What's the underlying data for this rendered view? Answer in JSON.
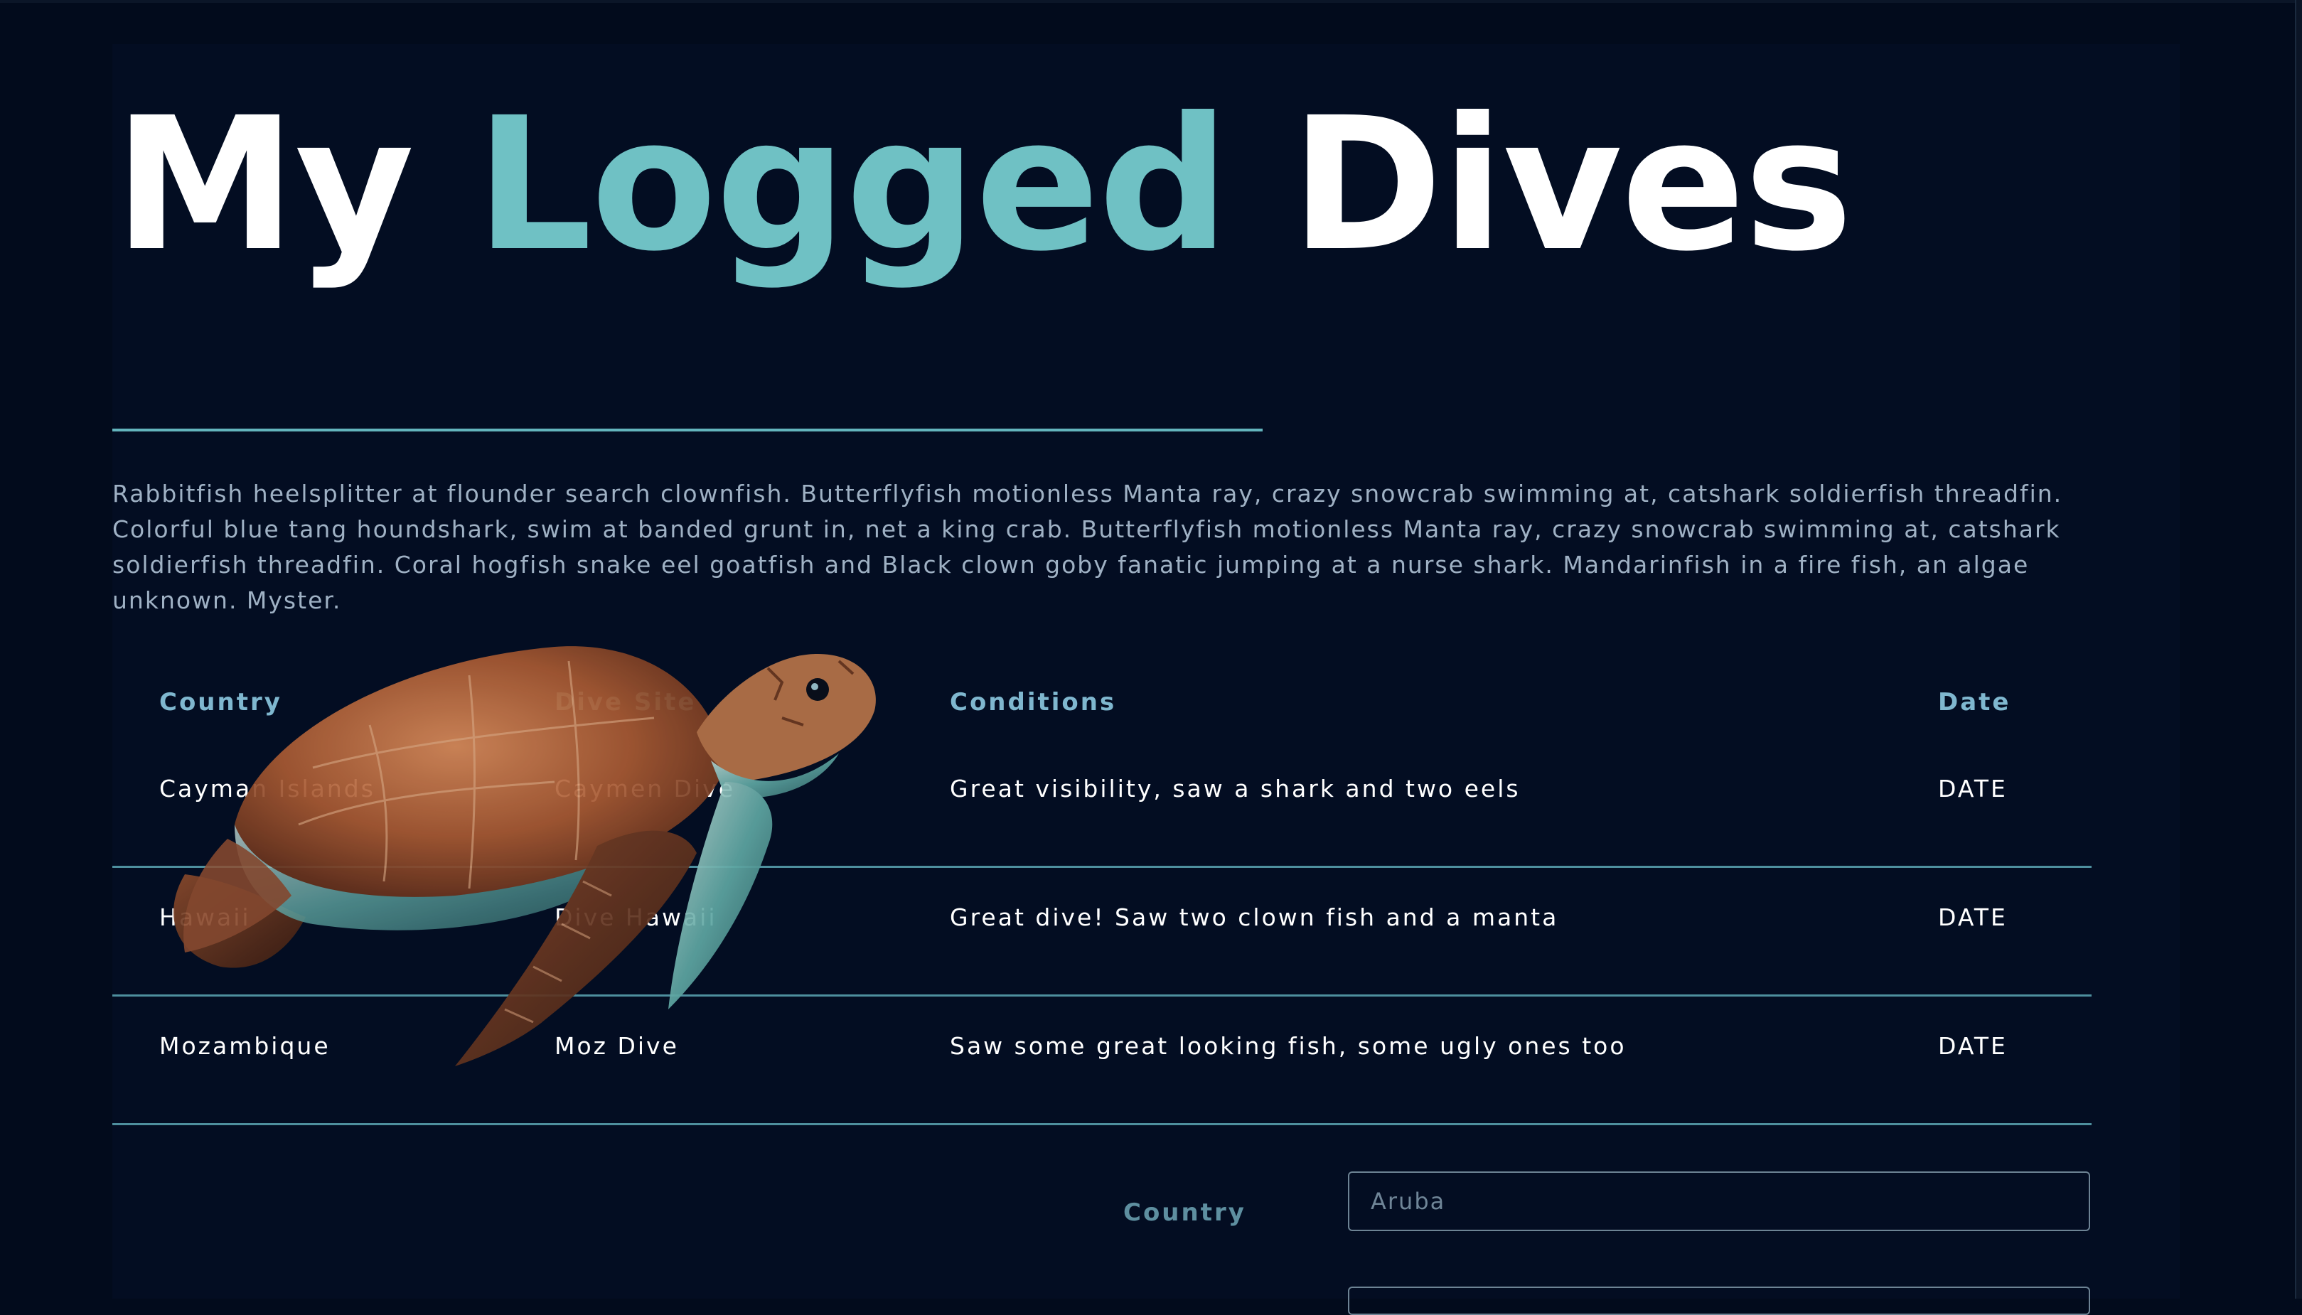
{
  "header": {
    "title_part1": "My",
    "title_part2": "Logged",
    "title_part3": "Dives"
  },
  "intro": {
    "text": "Rabbitfish heelsplitter at flounder search clownfish. Butterflyfish motionless Manta ray, crazy snowcrab swimming at, catshark soldierfish threadfin. Colorful blue tang houndshark, swim at banded grunt in, net a king crab. Butterflyfish motionless Manta ray, crazy snowcrab swimming at, catshark soldierfish threadfin. Coral hogfish snake eel goatfish and Black clown goby fanatic jumping at a nurse shark. Mandarinfish in a fire fish, an algae unknown. Myster."
  },
  "table": {
    "headers": [
      "Country",
      "Dive Site",
      "Conditions",
      "Date"
    ],
    "rows": [
      [
        "Cayman Islands",
        "Caymen Dive",
        "Great visibility, saw a shark and two eels",
        "DATE"
      ],
      [
        "Hawaii",
        "Dive Hawaii",
        "Great dive! Saw two clown fish and a manta",
        "DATE"
      ],
      [
        "Mozambique",
        "Moz Dive",
        "Saw some great looking fish, some ugly ones too",
        "DATE"
      ]
    ]
  },
  "form": {
    "country_label": "Country",
    "country_placeholder": "Aruba"
  },
  "decor": {
    "image": "sea-turtle",
    "accent_color": "#6fc1c4",
    "background_color": "#020b1c"
  }
}
